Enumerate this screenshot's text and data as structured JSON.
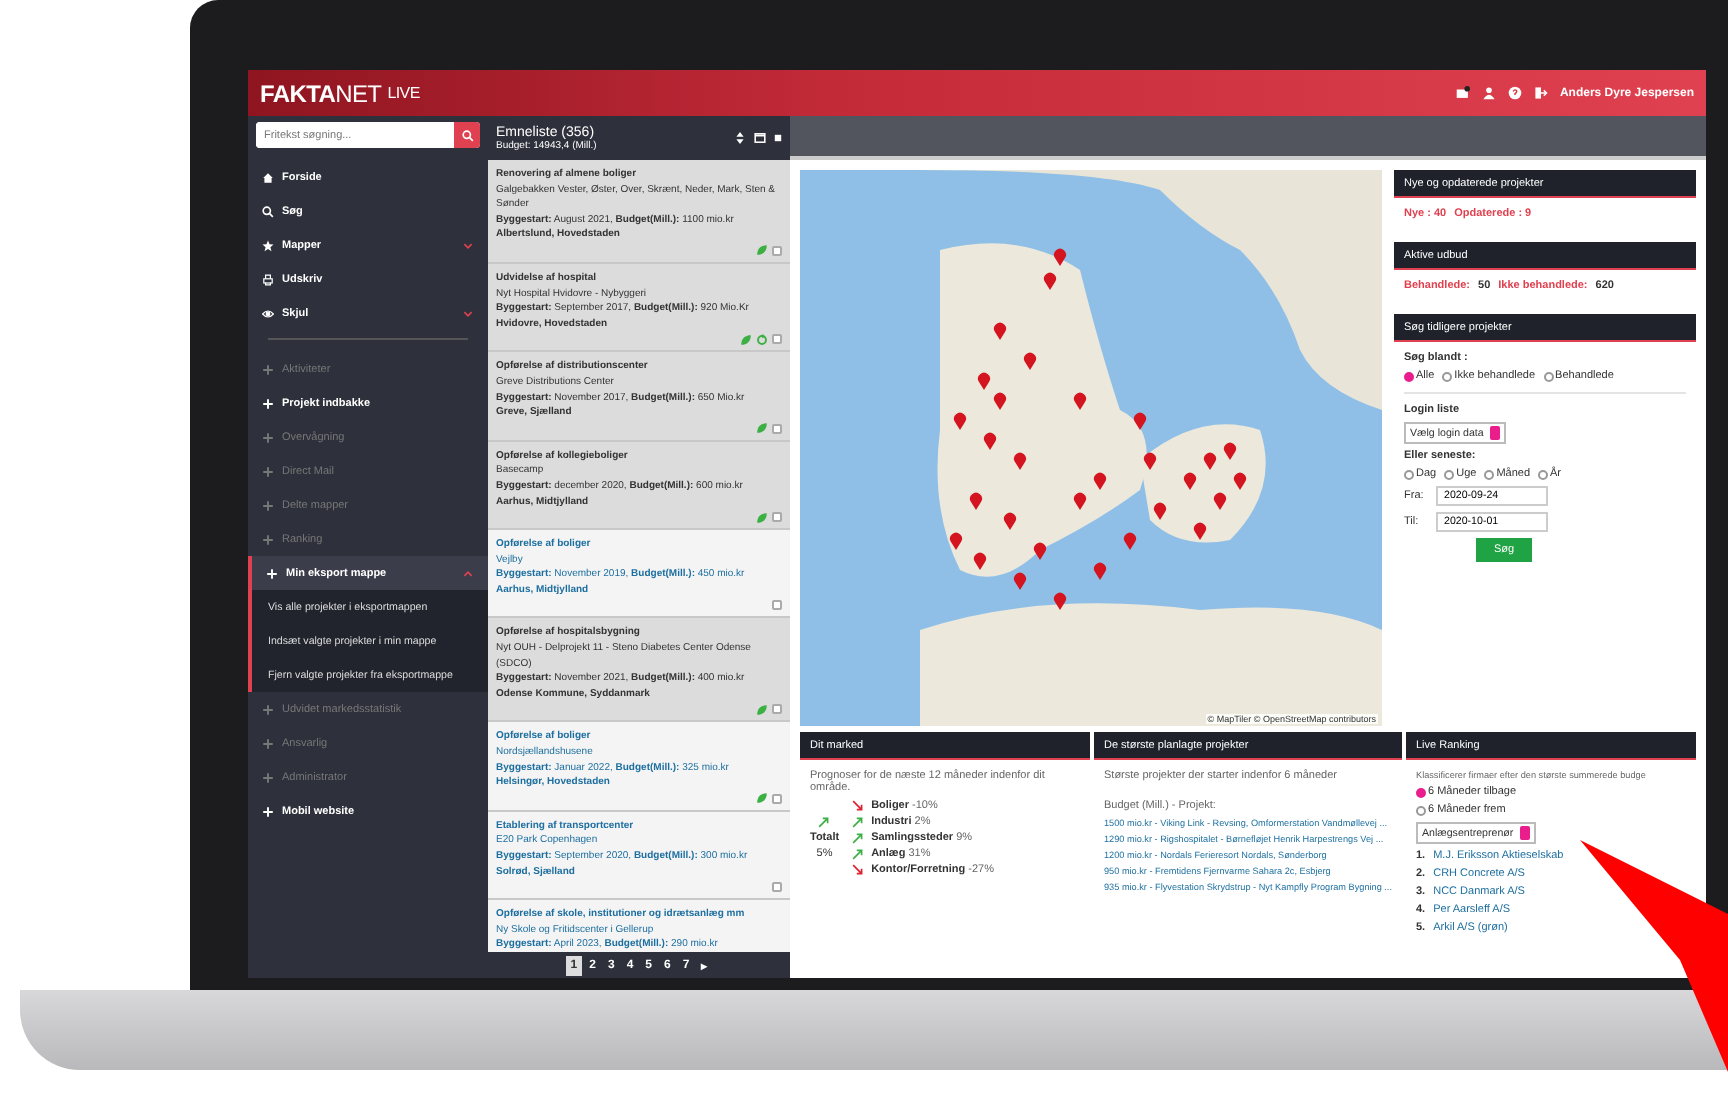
{
  "header": {
    "logo": {
      "bold": "FAKTA",
      "light": "NET",
      "tag": "LIVE"
    },
    "user": "Anders Dyre Jespersen"
  },
  "sidebar": {
    "search": {
      "placeholder": "Fritekst søgning..."
    },
    "nav": [
      {
        "label": "Forside",
        "has_menu": false
      },
      {
        "label": "Søg",
        "has_menu": false
      },
      {
        "label": "Mapper",
        "has_menu": true
      },
      {
        "label": "Udskriv",
        "has_menu": false
      },
      {
        "label": "Skjul",
        "has_menu": true
      }
    ],
    "sections": [
      {
        "label": "Aktiviteter",
        "disabled": true,
        "expanded": false
      },
      {
        "label": "Projekt indbakke",
        "disabled": false,
        "expanded": false
      },
      {
        "label": "Overvågning",
        "disabled": true,
        "expanded": false
      },
      {
        "label": "Direct Mail",
        "disabled": true,
        "expanded": false
      },
      {
        "label": "Delte mapper",
        "disabled": true,
        "expanded": false
      },
      {
        "label": "Ranking",
        "disabled": true,
        "expanded": false
      },
      {
        "label": "Min eksport mappe",
        "disabled": false,
        "expanded": true,
        "children": [
          "Vis alle projekter i eksportmappen",
          "Indsæt valgte projekter i min mappe",
          "Fjern valgte projekter fra eksportmappe"
        ]
      },
      {
        "label": "Udvidet markedsstatistik",
        "disabled": true,
        "expanded": false
      },
      {
        "label": "Ansvarlig",
        "disabled": true,
        "expanded": false
      },
      {
        "label": "Administrator",
        "disabled": true,
        "expanded": false
      },
      {
        "label": "Mobil website",
        "disabled": false,
        "expanded": false
      }
    ]
  },
  "project_list": {
    "title": "Emneliste (356)",
    "budget": "Budget: 14943,4 (Mill.)",
    "items": [
      {
        "title": "Renovering af almene boliger",
        "subtitle": "Galgebakken Vester, Øster, Over, Skrænt, Neder, Mark, Sten & Sønder",
        "details": "**Byggestart:** August 2021, **Budget(Mill.):** 1100 mio.kr",
        "location": "Albertslund, Hovedstaden",
        "selected": false,
        "green": true,
        "recycled": false,
        "checked": false
      },
      {
        "title": "Udvidelse af hospital",
        "subtitle": "Nyt Hospital Hvidovre - Nybyggeri",
        "details": "**Byggestart:** September 2017, **Budget(Mill.):** 920 Mio.Kr",
        "location": "Hvidovre, Hovedstaden",
        "selected": false,
        "green": true,
        "recycled": true,
        "checked": false
      },
      {
        "title": "Opførelse af distributionscenter",
        "subtitle": "Greve Distributions Center",
        "details": "**Byggestart:** November 2017, **Budget(Mill.):** 650 Mio.kr",
        "location": "Greve, Sjælland",
        "selected": false,
        "green": true,
        "recycled": false,
        "checked": false
      },
      {
        "title": "Opførelse af kollegieboliger",
        "subtitle": "Basecamp",
        "details": "**Byggestart:** december 2020, **Budget(Mill.):** 600 mio.kr",
        "location": "Aarhus, Midtjylland",
        "selected": false,
        "green": true,
        "recycled": false,
        "checked": false
      },
      {
        "title": "Opførelse af boliger",
        "subtitle": "Vejlby",
        "details": "**Byggestart:** November 2019, **Budget(Mill.):** 450 mio.kr",
        "location": "Aarhus, Midtjylland",
        "selected": true,
        "green": false,
        "recycled": false,
        "checked": false
      },
      {
        "title": "Opførelse af hospitalsbygning",
        "subtitle": "Nyt OUH - Delprojekt 11 - Steno Diabetes Center Odense (SDCO)",
        "details": "**Byggestart:** November 2021, **Budget(Mill.):** 400 mio.kr",
        "location": "Odense Kommune, Syddanmark",
        "selected": false,
        "green": true,
        "recycled": false,
        "checked": false
      },
      {
        "title": "Opførelse af boliger",
        "subtitle": "Nordsjællandshusene",
        "details": "**Byggestart:** Januar 2022, **Budget(Mill.):** 325 mio.kr",
        "location": "Helsingør, Hovedstaden",
        "selected": true,
        "green": true,
        "recycled": false,
        "checked": false
      },
      {
        "title": "Etablering af transportcenter",
        "subtitle": "E20 Park Copenhagen",
        "details": "**Byggestart:** September 2020, **Budget(Mill.):** 300 mio.kr",
        "location": "Solrød, Sjælland",
        "selected": true,
        "green": false,
        "recycled": false,
        "checked": false
      },
      {
        "title": "Opførelse af skole, institutioner og idrætsanlæg mm",
        "subtitle": "Ny Skole og Fritidscenter i Gellerup",
        "details": "**Byggestart:** April 2023, **Budget(Mill.):** 290 mio.kr",
        "selected": true
      }
    ],
    "pages": [
      {
        "label": "1",
        "selected": true
      },
      {
        "label": "2",
        "selected": false
      },
      {
        "label": "3",
        "selected": false
      },
      {
        "label": "4",
        "selected": false
      },
      {
        "label": "5",
        "selected": false
      },
      {
        "label": "6",
        "selected": false
      },
      {
        "label": "7",
        "selected": false
      },
      {
        "label": "▸",
        "selected": false
      }
    ]
  },
  "map": {
    "attribution": "© MapTiler © OpenStreetMap contributors"
  },
  "new_projects": {
    "title": "Nye og opdaterede projekter",
    "new": "Nye : 40",
    "updated": "Opdaterede : 9"
  },
  "tenders": {
    "title": "Aktive udbud",
    "handled_label": "Behandlede:",
    "handled": "50",
    "unhandled_label": "Ikke behandlede:",
    "unhandled": "620"
  },
  "search_previous": {
    "title": "Søg tidligere projekter",
    "among_label": "Søg blandt :",
    "among": [
      {
        "label": "Alle",
        "selected": true
      },
      {
        "label": "Ikke behandlede",
        "selected": false
      },
      {
        "label": "Behandlede",
        "selected": false
      }
    ],
    "login_label": "Login liste",
    "login_select": "Vælg login data",
    "recent_label": "Eller seneste:",
    "recent": [
      {
        "label": "Dag",
        "selected": false
      },
      {
        "label": "Uge",
        "selected": false
      },
      {
        "label": "Måned",
        "selected": false
      },
      {
        "label": "År",
        "selected": false
      }
    ],
    "from_label": "Fra:",
    "from": "2020-09-24",
    "to_label": "Til:",
    "to": "2020-10-01",
    "button": "Søg"
  },
  "market": {
    "title": "Dit marked",
    "intro": "Prognoser for de næste 12 måneder indenfor dit område.",
    "total": {
      "label": "Totalt",
      "value": "5%",
      "kind": "up"
    },
    "rows": [
      {
        "label": "Boliger",
        "value": "-10%",
        "kind": "down"
      },
      {
        "label": "Industri",
        "value": "2%",
        "kind": "up"
      },
      {
        "label": "Samlingssteder",
        "value": "9%",
        "kind": "up"
      },
      {
        "label": "Anlæg",
        "value": "31%",
        "kind": "up"
      },
      {
        "label": "Kontor/Forretning",
        "value": "-27%",
        "kind": "down"
      }
    ]
  },
  "largest": {
    "title": "De største planlagte projekter",
    "intro": "Største projekter der starter indenfor 6 måneder",
    "legend": "Budget (Mill.) - Projekt:",
    "links": [
      "1500 mio.kr - Viking Link - Revsing, Omformerstation Vandmøllevej ...",
      "1290 mio.kr - Rigshospitalet - Børnefløjet Henrik Harpestrengs Vej ...",
      "1200 mio.kr - Nordals Ferieresort Nordals, Sønderborg",
      "950 mio.kr - Fremtidens Fjernvarme Sahara 2c, Esbjerg",
      "935 mio.kr - Flyvestation Skrydstrup - Nyt Kampfly Program Bygning ..."
    ]
  },
  "ranking": {
    "title": "Live Ranking",
    "intro": "Klassificerer firmaer efter den største summerede budge",
    "options": [
      {
        "label": "6 Måneder tilbage",
        "selected": true
      },
      {
        "label": "6 Måneder frem",
        "selected": false
      }
    ],
    "select": "Anlægsentreprenør",
    "firms": [
      {
        "rank": "1.",
        "name": "M.J. Eriksson Aktieselskab"
      },
      {
        "rank": "2.",
        "name": "CRH Concrete A/S"
      },
      {
        "rank": "3.",
        "name": "NCC Danmark A/S"
      },
      {
        "rank": "4.",
        "name": "Per Aarsleff A/S"
      },
      {
        "rank": "5.",
        "name": "Arkil A/S (grøn)"
      }
    ]
  }
}
